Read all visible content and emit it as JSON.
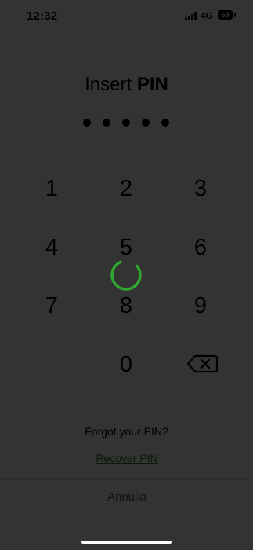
{
  "status_bar": {
    "time": "12:32",
    "network": "4G",
    "battery": "69"
  },
  "title": {
    "light": "Insert",
    "bold": "PIN"
  },
  "pin": {
    "length": 5,
    "entered": 5
  },
  "keypad": {
    "keys": [
      "1",
      "2",
      "3",
      "4",
      "5",
      "6",
      "7",
      "8",
      "9",
      "0"
    ],
    "backspace_icon": "backspace-icon"
  },
  "loading": {
    "spinner_color": "#2fa82f",
    "icon": "loading-spinner-icon"
  },
  "footer": {
    "forgot_text": "Forgot your PIN?",
    "recover_link": "Recover PIN",
    "cancel_label": "Annulla"
  },
  "colors": {
    "link": "#2e7d1e",
    "overlay": "rgba(0,0,0,0.8)"
  }
}
